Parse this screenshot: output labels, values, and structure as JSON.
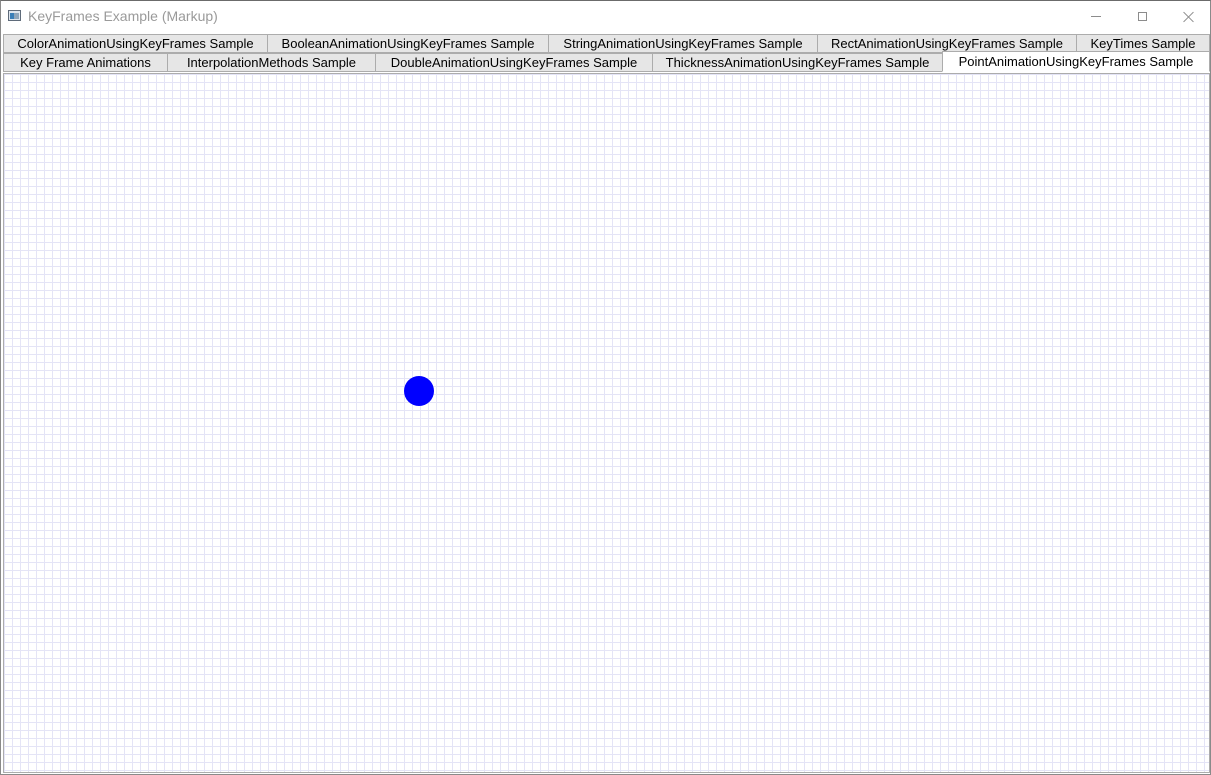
{
  "window": {
    "title": "KeyFrames Example (Markup)",
    "icon": "app-window-icon",
    "controls": [
      "minimize-icon",
      "maximize-icon",
      "close-icon"
    ]
  },
  "tabs": {
    "row_back": [
      {
        "label": "ColorAnimationUsingKeyFrames Sample"
      },
      {
        "label": "BooleanAnimationUsingKeyFrames Sample"
      },
      {
        "label": "StringAnimationUsingKeyFrames Sample"
      },
      {
        "label": "RectAnimationUsingKeyFrames Sample"
      },
      {
        "label": "KeyTimes Sample"
      }
    ],
    "row_front": [
      {
        "label": "Key Frame Animations"
      },
      {
        "label": "InterpolationMethods Sample"
      },
      {
        "label": "DoubleAnimationUsingKeyFrames Sample"
      },
      {
        "label": "ThicknessAnimationUsingKeyFrames Sample"
      },
      {
        "label": "PointAnimationUsingKeyFrames Sample",
        "selected": true
      }
    ]
  },
  "content": {
    "ball_color": "#0000ff",
    "grid_color": "#e4e4f6"
  }
}
